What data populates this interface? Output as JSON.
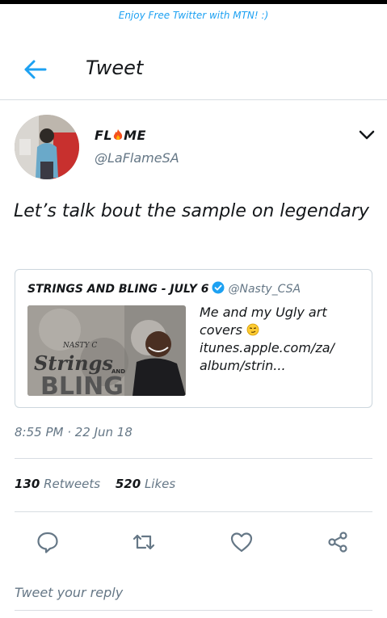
{
  "banner": "Enjoy Free Twitter with MTN! :)",
  "header": {
    "title": "Tweet"
  },
  "tweet": {
    "name_prefix": "FL",
    "name_suffix": "ME",
    "handle": "@LaFlameSA",
    "text": "Let’s talk bout the sample on legendary",
    "timestamp": "8:55 PM · 22 Jun 18",
    "retweets_count": "130",
    "retweets_label": "Retweets",
    "likes_count": "520",
    "likes_label": "Likes"
  },
  "quoted": {
    "name": "STRINGS AND BLING - JULY 6",
    "handle": "@Nasty_CSA",
    "text_line": "Me and my Ugly art covers",
    "link_line1": "itunes.apple.com/za/",
    "link_line2": "album/strin...",
    "image_text_brand": "NASTY C",
    "image_text_title": "Strings",
    "image_text_and": "AND",
    "image_text_bling": "BLING"
  },
  "reply": {
    "placeholder": "Tweet your reply"
  },
  "colors": {
    "accent": "#1da1f2",
    "muted": "#657786",
    "divider": "#d8dde2"
  },
  "icons": [
    "back-arrow-icon",
    "fire-icon",
    "chevron-down-icon",
    "verified-badge-icon",
    "smirk-emoji-icon",
    "reply-icon",
    "retweet-icon",
    "like-heart-icon",
    "share-icon"
  ]
}
